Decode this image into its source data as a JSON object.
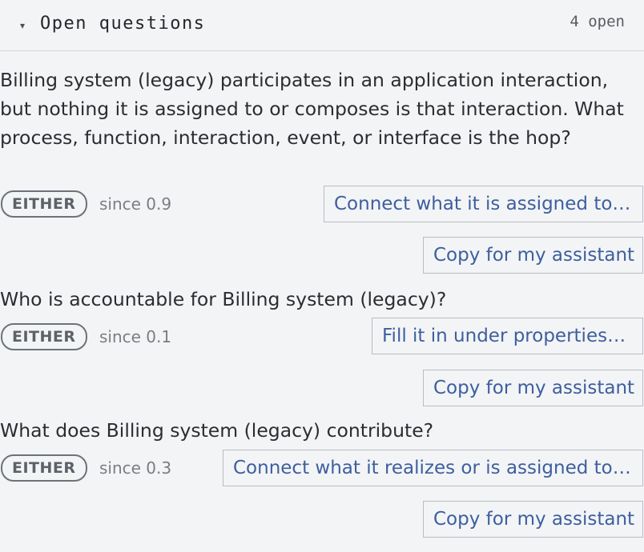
{
  "header": {
    "caret_glyph": "▾",
    "title": "Open questions",
    "open_count": "4 open"
  },
  "questions": [
    {
      "text": "Billing system (legacy) participates in an application interaction, but nothing it is assigned to or composes is that interaction. What process, function, interaction, event, or interface is the hop?",
      "badge": "EITHER",
      "since": "since 0.9",
      "action": "Connect what it is assigned to…",
      "copy": "Copy for my assistant"
    },
    {
      "text": "Who is accountable for Billing system (legacy)?",
      "badge": "EITHER",
      "since": "since 0.1",
      "action": "Fill it in under properties…",
      "copy": "Copy for my assistant"
    },
    {
      "text": "What does Billing system (legacy) contribute?",
      "badge": "EITHER",
      "since": "since 0.3",
      "action": "Connect what it realizes or is assigned to…",
      "copy": "Copy for my assistant"
    }
  ]
}
